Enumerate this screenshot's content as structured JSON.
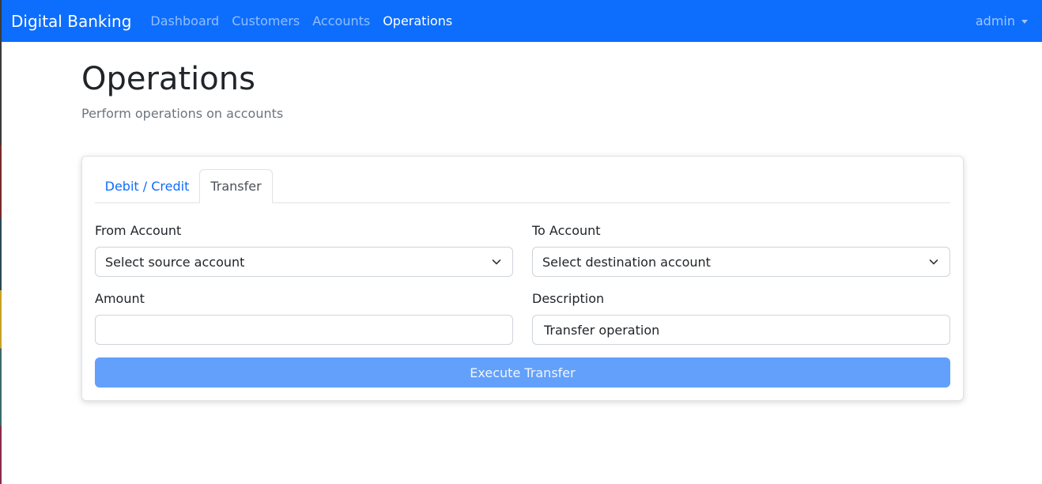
{
  "navbar": {
    "brand": "Digital Banking",
    "links": [
      {
        "label": "Dashboard",
        "active": false
      },
      {
        "label": "Customers",
        "active": false
      },
      {
        "label": "Accounts",
        "active": false
      },
      {
        "label": "Operations",
        "active": true
      }
    ],
    "user": "admin",
    "color": "#0d6efd"
  },
  "page": {
    "title": "Operations",
    "subtitle": "Perform operations on accounts"
  },
  "tabs": [
    {
      "label": "Debit / Credit",
      "active": false
    },
    {
      "label": "Transfer",
      "active": true
    }
  ],
  "form": {
    "from_account": {
      "label": "From Account",
      "selected": "Select source account"
    },
    "to_account": {
      "label": "To Account",
      "selected": "Select destination account"
    },
    "amount": {
      "label": "Amount",
      "value": ""
    },
    "description": {
      "label": "Description",
      "value": "Transfer operation"
    },
    "submit_label": "Execute Transfer",
    "submit_color": "#62a0fb"
  }
}
